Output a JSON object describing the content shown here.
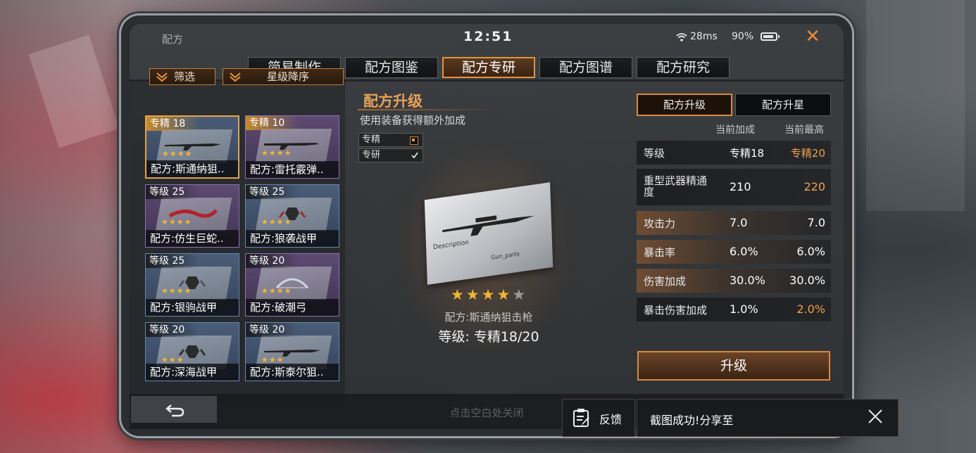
{
  "statusbar": {
    "title": "配方",
    "clock": "12:51",
    "ping": "28ms",
    "battery": "90%"
  },
  "tabs": [
    {
      "label": "简易制作",
      "active": false
    },
    {
      "label": "配方图鉴",
      "active": false
    },
    {
      "label": "配方专研",
      "active": true
    },
    {
      "label": "配方图谱",
      "active": false
    },
    {
      "label": "配方研究",
      "active": false
    }
  ],
  "filters": {
    "filter_label": "筛选",
    "sort_label": "星级降序"
  },
  "cards": [
    {
      "badge": "专精 18",
      "name": "配方:斯通纳狙..",
      "stars": "★★★★",
      "selected": true
    },
    {
      "badge": "专精 10",
      "name": "配方:雷托霰弹..",
      "stars": "★★★★"
    },
    {
      "badge": "等级 25",
      "name": "配方:仿生巨蛇..",
      "stars": "★★★★"
    },
    {
      "badge": "等级 25",
      "name": "配方:狼袭战甲",
      "stars": "★★★★"
    },
    {
      "badge": "等级 25",
      "name": "配方:银驹战甲",
      "stars": "★★★★"
    },
    {
      "badge": "等级 20",
      "name": "配方:破潮弓",
      "stars": "★★★★"
    },
    {
      "badge": "等级 20",
      "name": "配方:深海战甲",
      "stars": "★★★"
    },
    {
      "badge": "等级 20",
      "name": "配方:斯泰尔狙..",
      "stars": "★★★"
    }
  ],
  "center": {
    "title": "配方升级",
    "subtitle": "使用装备获得额外加成",
    "checks": [
      {
        "label": "专精",
        "state": "partial"
      },
      {
        "label": "专研",
        "state": "checked"
      }
    ],
    "paper_text_1": "Description",
    "paper_text_2": "Gun_parts",
    "stars_on": 4,
    "stars_total": 5,
    "item_name": "配方:斯通纳狙击枪",
    "level_text": "等级: 专精18/20"
  },
  "right": {
    "tab_upgrade": "配方升级",
    "tab_star": "配方升星",
    "header_current": "当前加成",
    "header_max": "当前最高",
    "rows": [
      {
        "key": "等级",
        "current": "专精18",
        "max": "专精20",
        "up": true
      },
      {
        "key": "重型武器精通度",
        "current": "210",
        "max": "220",
        "up": true
      },
      {
        "key": "攻击力",
        "current": "7.0",
        "max": "7.0",
        "up": false
      },
      {
        "key": "暴击率",
        "current": "6.0%",
        "max": "6.0%",
        "up": false
      },
      {
        "key": "伤害加成",
        "current": "30.0%",
        "max": "30.0%",
        "up": false
      },
      {
        "key": "暴击伤害加成",
        "current": "1.0%",
        "max": "2.0%",
        "up": true
      }
    ],
    "upgrade_button": "升级"
  },
  "bottom": {
    "hint": "点击空白处关闭"
  },
  "toast": {
    "feedback": "反馈",
    "message": "截图成功!分享至"
  },
  "colors": {
    "accent": "#e6933c",
    "highlight_value": "#f1a04e"
  }
}
